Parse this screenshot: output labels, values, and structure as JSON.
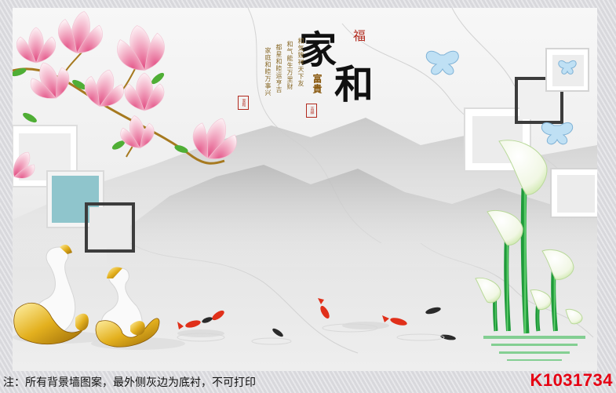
{
  "mural": {
    "big_char_1": "家",
    "big_char_2": "和",
    "fu_char": "福",
    "fugui": "富貴",
    "poem_columns": [
      "和気致祥天下友",
      "和气能生万里财",
      "都星和睦运亨吉",
      "家庭和睦万事兴"
    ],
    "seal_left": "家和",
    "seal_mid": "吉祥"
  },
  "footer": {
    "note": "注：所有背景墙图案，最外侧灰边为底衬，不可打印",
    "code": "K1031734"
  },
  "colors": {
    "code_red": "#e60012",
    "magnolia_pink": "#e86a96",
    "koi_red": "#e0301a",
    "swan_gold": "#d9a61a",
    "calla_green": "#2fb84a",
    "frame_teal": "#8fc5cc",
    "frame_dark": "#3c3c3c"
  }
}
